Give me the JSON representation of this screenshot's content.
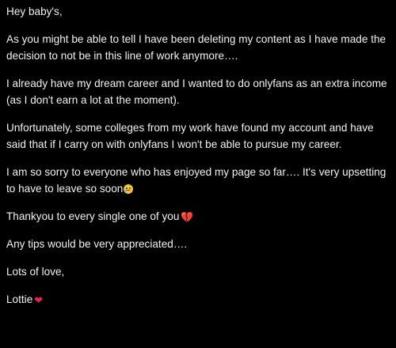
{
  "post": {
    "greeting": "Hey baby's,",
    "p1": "As you might be able to tell I have been deleting my content as I have made the decision to not be in this line of work anymore….",
    "p2": "I already have my dream career and I wanted to do onlyfans as an extra income (as I don't earn a lot at the moment).",
    "p3": "Unfortunately, some colleges from my work have found my account and have said that if I carry on with onlyfans I won't be able to pursue my career.",
    "p4": "I am so sorry to everyone who has enjoyed my page so far…. It's very upsetting to have to leave so soon",
    "p5": "Thankyou to every single one of you",
    "p6": "Any tips would be very appreciated….",
    "closing": "Lots of love,",
    "signature": "Lottie"
  },
  "emojis": {
    "sad": "sad-crying-face-icon",
    "broken_heart": "💔",
    "heart": "❤"
  },
  "colors": {
    "background": "#000000",
    "text": "#f2f2f2",
    "heart": "#e0284f"
  }
}
